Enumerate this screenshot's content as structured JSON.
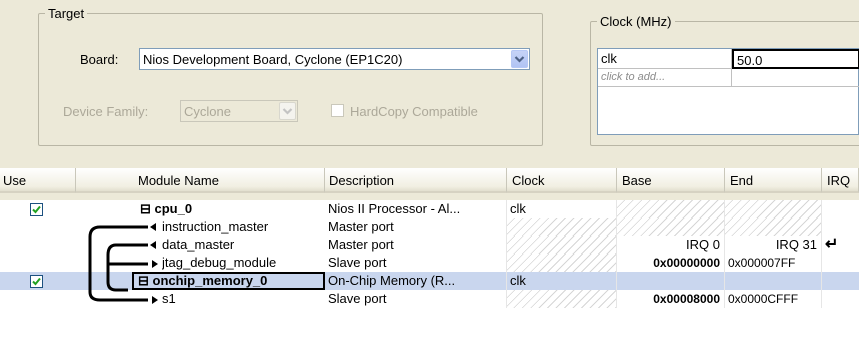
{
  "target": {
    "legend": "Target",
    "board_label": "Board:",
    "board_value": "Nios Development Board, Cyclone (EP1C20)",
    "family_label": "Device Family:",
    "family_value": "Cyclone",
    "hardcopy_label": "HardCopy Compatible"
  },
  "clock": {
    "legend": "Clock (MHz)",
    "rows": [
      {
        "name": "clk",
        "value": "50.0"
      }
    ],
    "add_placeholder": "click to add..."
  },
  "table": {
    "headers": [
      "Use",
      "Module Name",
      "Description",
      "Clock",
      "Base",
      "End",
      "IRQ"
    ],
    "rows": [
      {
        "use": true,
        "name": "⊟ cpu_0",
        "desc": "Nios II Processor - Al...",
        "clock": "clk",
        "base": "",
        "end": "",
        "irq": ""
      },
      {
        "name": "instruction_master",
        "desc": "Master port",
        "clock": "",
        "base": "",
        "end": "",
        "irq": ""
      },
      {
        "name": "data_master",
        "desc": "Master port",
        "clock": "",
        "base": "IRQ 0",
        "end": "IRQ 31",
        "irq": "↵"
      },
      {
        "name": "jtag_debug_module",
        "desc": "Slave port",
        "clock": "",
        "base": "0x00000000",
        "end": "0x000007FF",
        "irq": ""
      },
      {
        "use": true,
        "name": "⊟ onchip_memory_0",
        "desc": "On-Chip Memory (R...",
        "clock": "clk",
        "base": "",
        "end": "",
        "irq": ""
      },
      {
        "name": "s1",
        "desc": "Slave port",
        "clock": "",
        "base": "0x00008000",
        "end": "0x0000CFFF",
        "irq": ""
      }
    ]
  },
  "colors": {
    "selected_row": "#c9d6ee",
    "check": "#21a121"
  },
  "icons": {
    "checkbox_checked": "checkmark-icon",
    "combo_arrow": "chevron-down-icon",
    "irq_arrow": "return-arrow-icon"
  }
}
